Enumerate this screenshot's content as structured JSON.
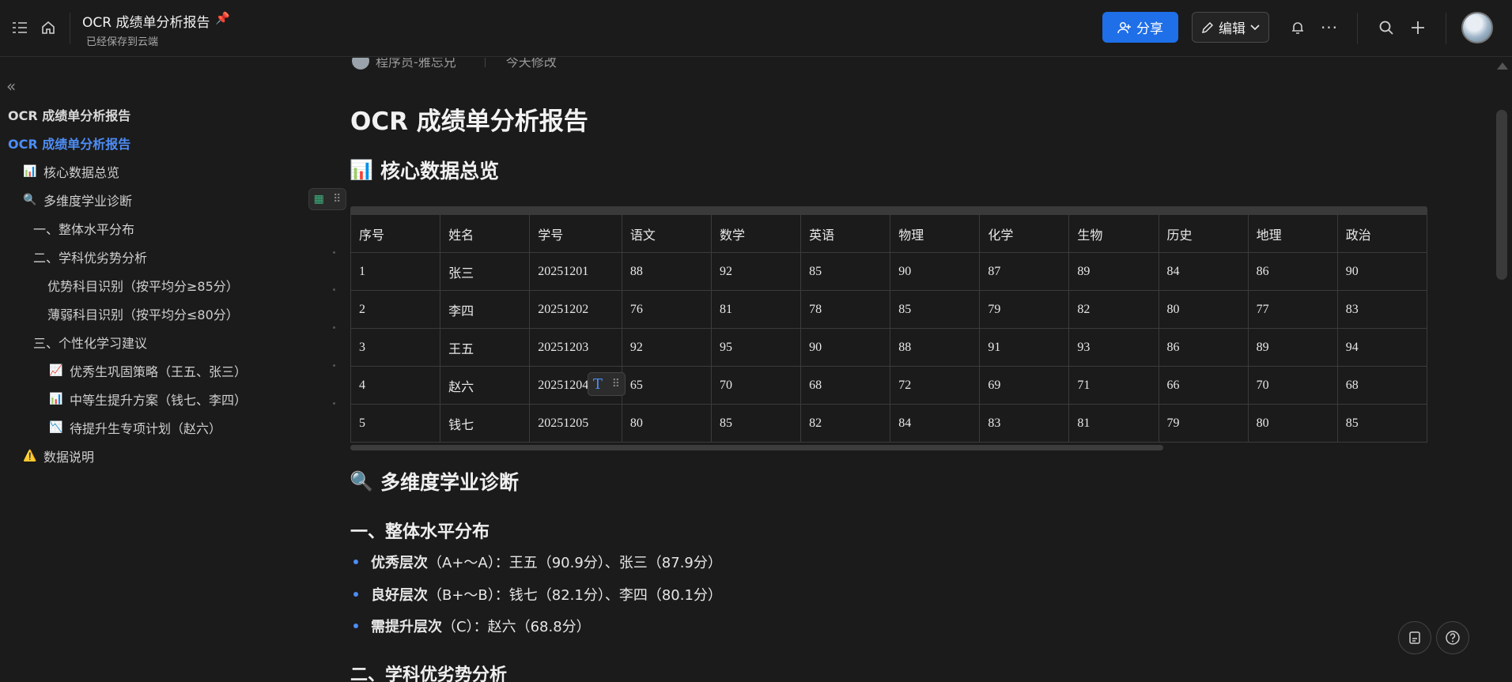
{
  "topbar": {
    "doc_title": "OCR 成绩单分析报告",
    "status": "已经保存到云端",
    "share_label": "分享",
    "edit_label": "编辑"
  },
  "sidebar": {
    "doc_title": "OCR 成绩单分析报告",
    "active_title": "OCR 成绩单分析报告",
    "items": [
      {
        "label": "核心数据总览",
        "emoji": "📊"
      },
      {
        "label": "多维度学业诊断",
        "emoji": "🔍"
      },
      {
        "label": "一、整体水平分布"
      },
      {
        "label": "二、学科优劣势分析"
      },
      {
        "label": "优势科目识别（按平均分≥85分）"
      },
      {
        "label": "薄弱科目识别（按平均分≤80分）"
      },
      {
        "label": "三、个性化学习建议"
      },
      {
        "label": "优秀生巩固策略（王五、张三）",
        "emoji": "📈"
      },
      {
        "label": "中等生提升方案（钱七、李四）",
        "emoji": "📊"
      },
      {
        "label": "待提升生专项计划（赵六）",
        "emoji": "📉"
      },
      {
        "label": "数据说明",
        "emoji": "⚠️"
      }
    ]
  },
  "content": {
    "author": "程序员-雅忘兄",
    "modified": "今天修改",
    "title": "OCR 成绩单分析报告",
    "section1": "核心数据总览",
    "section1_emoji": "📊",
    "table": {
      "headers": [
        "序号",
        "姓名",
        "学号",
        "语文",
        "数学",
        "英语",
        "物理",
        "化学",
        "生物",
        "历史",
        "地理",
        "政治"
      ],
      "rows": [
        [
          "1",
          "张三",
          "20251201",
          "88",
          "92",
          "85",
          "90",
          "87",
          "89",
          "84",
          "86",
          "90"
        ],
        [
          "2",
          "李四",
          "20251202",
          "76",
          "81",
          "78",
          "85",
          "79",
          "82",
          "80",
          "77",
          "83"
        ],
        [
          "3",
          "王五",
          "20251203",
          "92",
          "95",
          "90",
          "88",
          "91",
          "93",
          "86",
          "89",
          "94"
        ],
        [
          "4",
          "赵六",
          "20251204",
          "65",
          "70",
          "68",
          "72",
          "69",
          "71",
          "66",
          "70",
          "68"
        ],
        [
          "5",
          "钱七",
          "20251205",
          "80",
          "85",
          "82",
          "84",
          "83",
          "81",
          "79",
          "80",
          "85"
        ]
      ]
    },
    "section2": "多维度学业诊断",
    "section2_emoji": "🔍",
    "sub1": "一、整体水平分布",
    "bullets": [
      {
        "bold": "优秀层次",
        "rest": "（A+～A）：王五（90.9分）、张三（87.9分）"
      },
      {
        "bold": "良好层次",
        "rest": "（B+～B）：钱七（82.1分）、李四（80.1分）"
      },
      {
        "bold": "需提升层次",
        "rest": "（C）：赵六（68.8分）"
      }
    ],
    "sub2": "二、学科优劣势分析"
  }
}
